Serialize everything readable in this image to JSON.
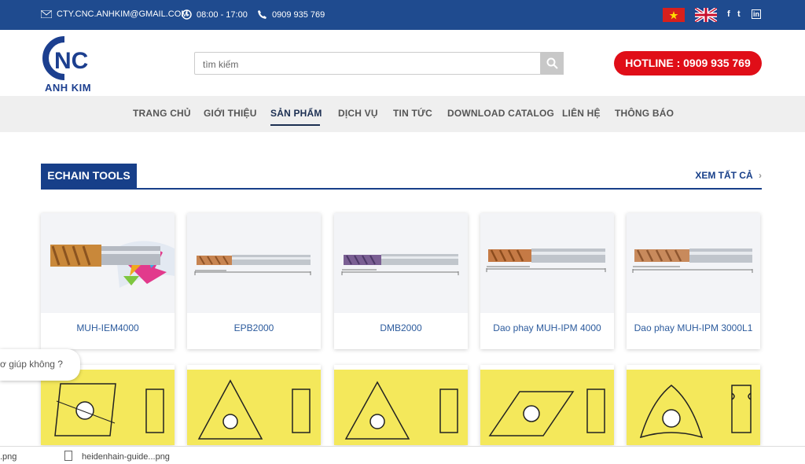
{
  "topbar": {
    "email": "CTY.CNC.ANHKIM@GMAIL.COM",
    "hours": "08:00 - 17:00",
    "phone": "0909 935 769",
    "social": [
      "f",
      "t",
      "in"
    ]
  },
  "header": {
    "logo_text": "ANH KIM",
    "logo_mark": "NC",
    "search_placeholder": "tìm kiếm",
    "hotline": "HOTLINE : 0909 935 769"
  },
  "nav": [
    "TRANG CHỦ",
    "GIỚI THIỆU",
    "SẢN PHẨM",
    "DỊCH VỤ",
    "TIN TỨC",
    "DOWNLOAD CATALOG",
    "LIÊN HỆ",
    "THÔNG BÁO"
  ],
  "section": {
    "title": "ECHAIN TOOLS",
    "view_all": "XEM TẤT CẢ"
  },
  "products": [
    "MUH-IEM4000",
    "EPB2000",
    "DMB2000",
    "Dao phay MUH-IPM 4000",
    "Dao phay MUH-IPM 3000L1"
  ],
  "chat": "ơ giúp không ?",
  "downloads": [
    ".png",
    "heidenhain-guide...png"
  ],
  "colors": {
    "brand_blue": "#1f4b8f",
    "hotline_red": "#e00e18",
    "insert_yellow": "#f4e85b"
  }
}
